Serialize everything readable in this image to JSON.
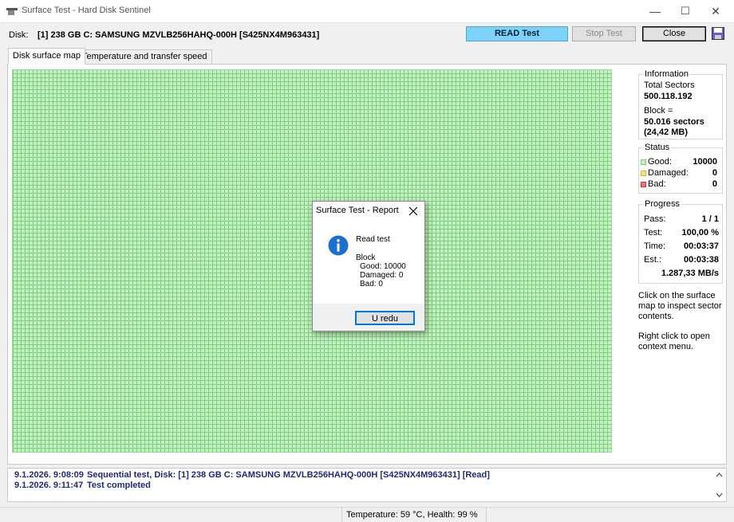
{
  "window": {
    "title": "Surface Test - Hard Disk Sentinel"
  },
  "window_controls": {
    "minimize": "—",
    "maximize": "☐",
    "close": "✕"
  },
  "disk": {
    "label": "Disk:",
    "name": "[1] 238 GB C: SAMSUNG MZVLB256HAHQ-000H [S425NX4M963431]"
  },
  "toolbar": {
    "read_test": "READ Test",
    "stop_test": "Stop Test",
    "close": "Close"
  },
  "tabs": [
    {
      "label": "Disk surface map"
    },
    {
      "label": "Temperature and transfer speed"
    }
  ],
  "colors": {
    "good": "#c2f0c2",
    "good_grid": "#7fcf7f",
    "damaged": "#f5e08a",
    "bad": "#f07070",
    "accent": "#7fd2f7",
    "log_text": "#1f2a7a"
  },
  "information": {
    "title": "Information",
    "total_sectors_label": "Total Sectors",
    "total_sectors": "500.118.192",
    "block_label": "Block =",
    "block_sectors": "50.016 sectors",
    "block_size": "(24,42 MB)"
  },
  "status": {
    "title": "Status",
    "good_label": "Good:",
    "good": "10000",
    "damaged_label": "Damaged:",
    "damaged": "0",
    "bad_label": "Bad:",
    "bad": "0"
  },
  "progress": {
    "title": "Progress",
    "pass_label": "Pass:",
    "pass": "1 / 1",
    "test_label": "Test:",
    "test": "100,00 %",
    "time_label": "Time:",
    "time": "00:03:37",
    "est_label": "Est.:",
    "est": "00:03:38",
    "speed": "1.287,33 MB/s"
  },
  "hints": {
    "click": "Click on the surface map to inspect sector contents.",
    "right_click": "Right click to open context menu."
  },
  "log": [
    {
      "time": "9.1.2026.  9:08:09",
      "message": "Sequential test, Disk: [1] 238 GB C: SAMSUNG MZVLB256HAHQ-000H [S425NX4M963431] [Read]"
    },
    {
      "time": "9.1.2026.  9:11:47",
      "message": "Test completed"
    }
  ],
  "statusbar": {
    "text": "Temperature: 59  °C,  Health: 99 %"
  },
  "dialog": {
    "title": "Surface Test - Report",
    "heading": "Read test",
    "block_label": "Block",
    "good": "Good: 10000",
    "damaged": "Damaged: 0",
    "bad": "Bad: 0",
    "ok_label": "U redu"
  }
}
